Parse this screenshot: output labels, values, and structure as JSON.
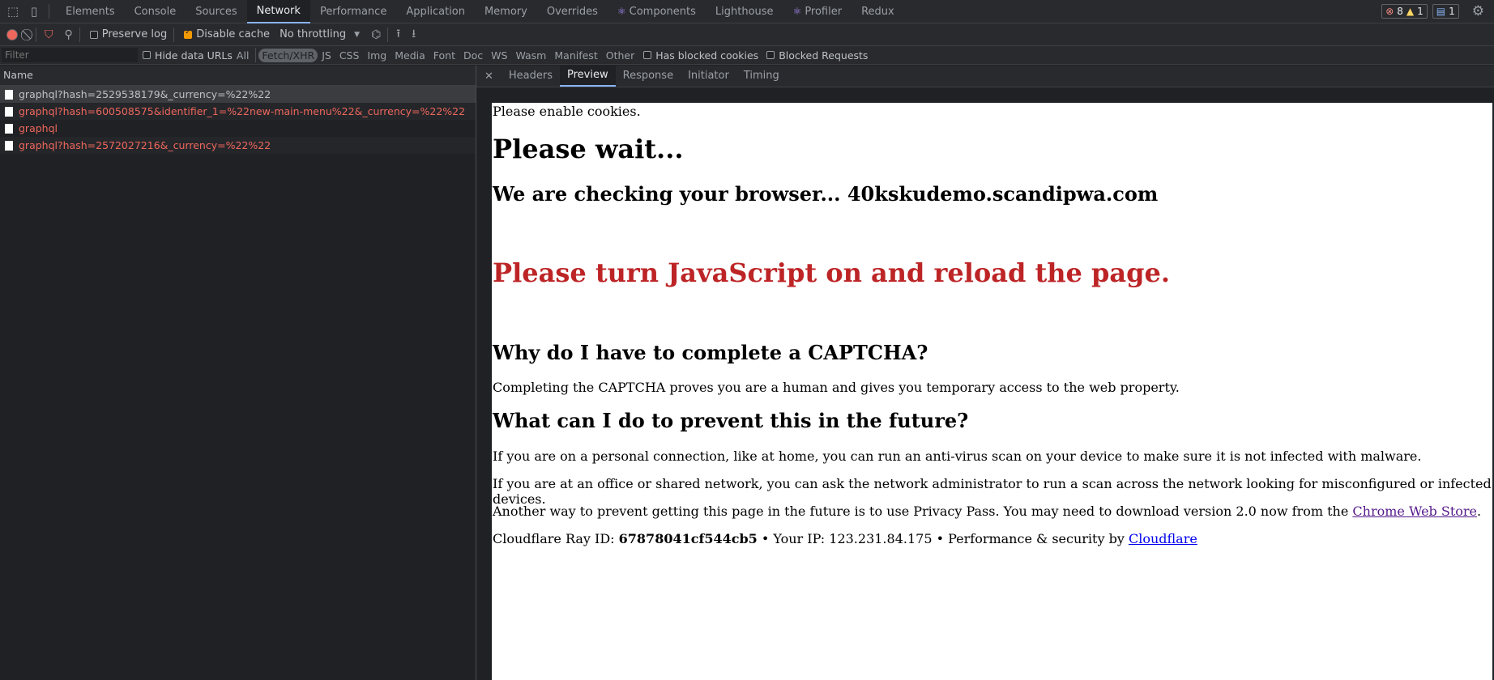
{
  "tabbar": {
    "tabs": [
      {
        "label": "Elements"
      },
      {
        "label": "Console"
      },
      {
        "label": "Sources"
      },
      {
        "label": "Network"
      },
      {
        "label": "Performance"
      },
      {
        "label": "Memory"
      },
      {
        "label": "Application"
      },
      {
        "label": "Overrides"
      },
      {
        "label": "Components"
      },
      {
        "label": "Lighthouse"
      },
      {
        "label": "Profiler"
      },
      {
        "label": "Redux"
      }
    ],
    "active_tab": "Network",
    "errors_count": "8",
    "warnings_count": "1",
    "messages_count": "1"
  },
  "toolbar": {
    "preserve_log": "Preserve log",
    "disable_cache": "Disable cache",
    "throttling": "No throttling"
  },
  "filterbar": {
    "filter_placeholder": "Filter",
    "hide_data_urls": "Hide data URLs",
    "types": [
      "All",
      "Fetch/XHR",
      "JS",
      "CSS",
      "Img",
      "Media",
      "Font",
      "Doc",
      "WS",
      "Wasm",
      "Manifest",
      "Other"
    ],
    "active_type": "Fetch/XHR",
    "has_blocked_cookies": "Has blocked cookies",
    "blocked_requests": "Blocked Requests"
  },
  "requests": {
    "header": "Name",
    "items": [
      {
        "name": "graphql?hash=2529538179&_currency=%22%22",
        "status": "selected"
      },
      {
        "name": "graphql?hash=600508575&identifier_1=%22new-main-menu%22&_currency=%22%22",
        "status": "error"
      },
      {
        "name": "graphql",
        "status": "error"
      },
      {
        "name": "graphql?hash=2572027216&_currency=%22%22",
        "status": "error"
      }
    ]
  },
  "detail": {
    "tabs": [
      "Headers",
      "Preview",
      "Response",
      "Initiator",
      "Timing"
    ],
    "active_tab": "Preview"
  },
  "preview": {
    "cookies": "Please enable cookies.",
    "wait": "Please wait...",
    "checking": "We are checking your browser... 40kskudemo.scandipwa.com",
    "js": "Please turn JavaScript on and reload the page.",
    "why_title": "Why do I have to complete a CAPTCHA?",
    "why_text": "Completing the CAPTCHA proves you are a human and gives you temporary access to the web property.",
    "what_title": "What can I do to prevent this in the future?",
    "what_p1": "If you are on a personal connection, like at home, you can run an anti-virus scan on your device to make sure it is not infected with malware.",
    "what_p2": "If you are at an office or shared network, you can ask the network administrator to run a scan across the network looking for misconfigured or infected devices.",
    "what_p3_prefix": "Another way to prevent getting this page in the future is to use Privacy Pass. You may need to download version 2.0 now from the ",
    "what_p3_link": "Chrome Web Store",
    "what_p3_suffix": ".",
    "ray_prefix": "Cloudflare Ray ID: ",
    "ray_id": "67878041cf544cb5",
    "ray_mid": " • Your IP: 123.231.84.175 • Performance & security by ",
    "ray_link": "Cloudflare"
  }
}
